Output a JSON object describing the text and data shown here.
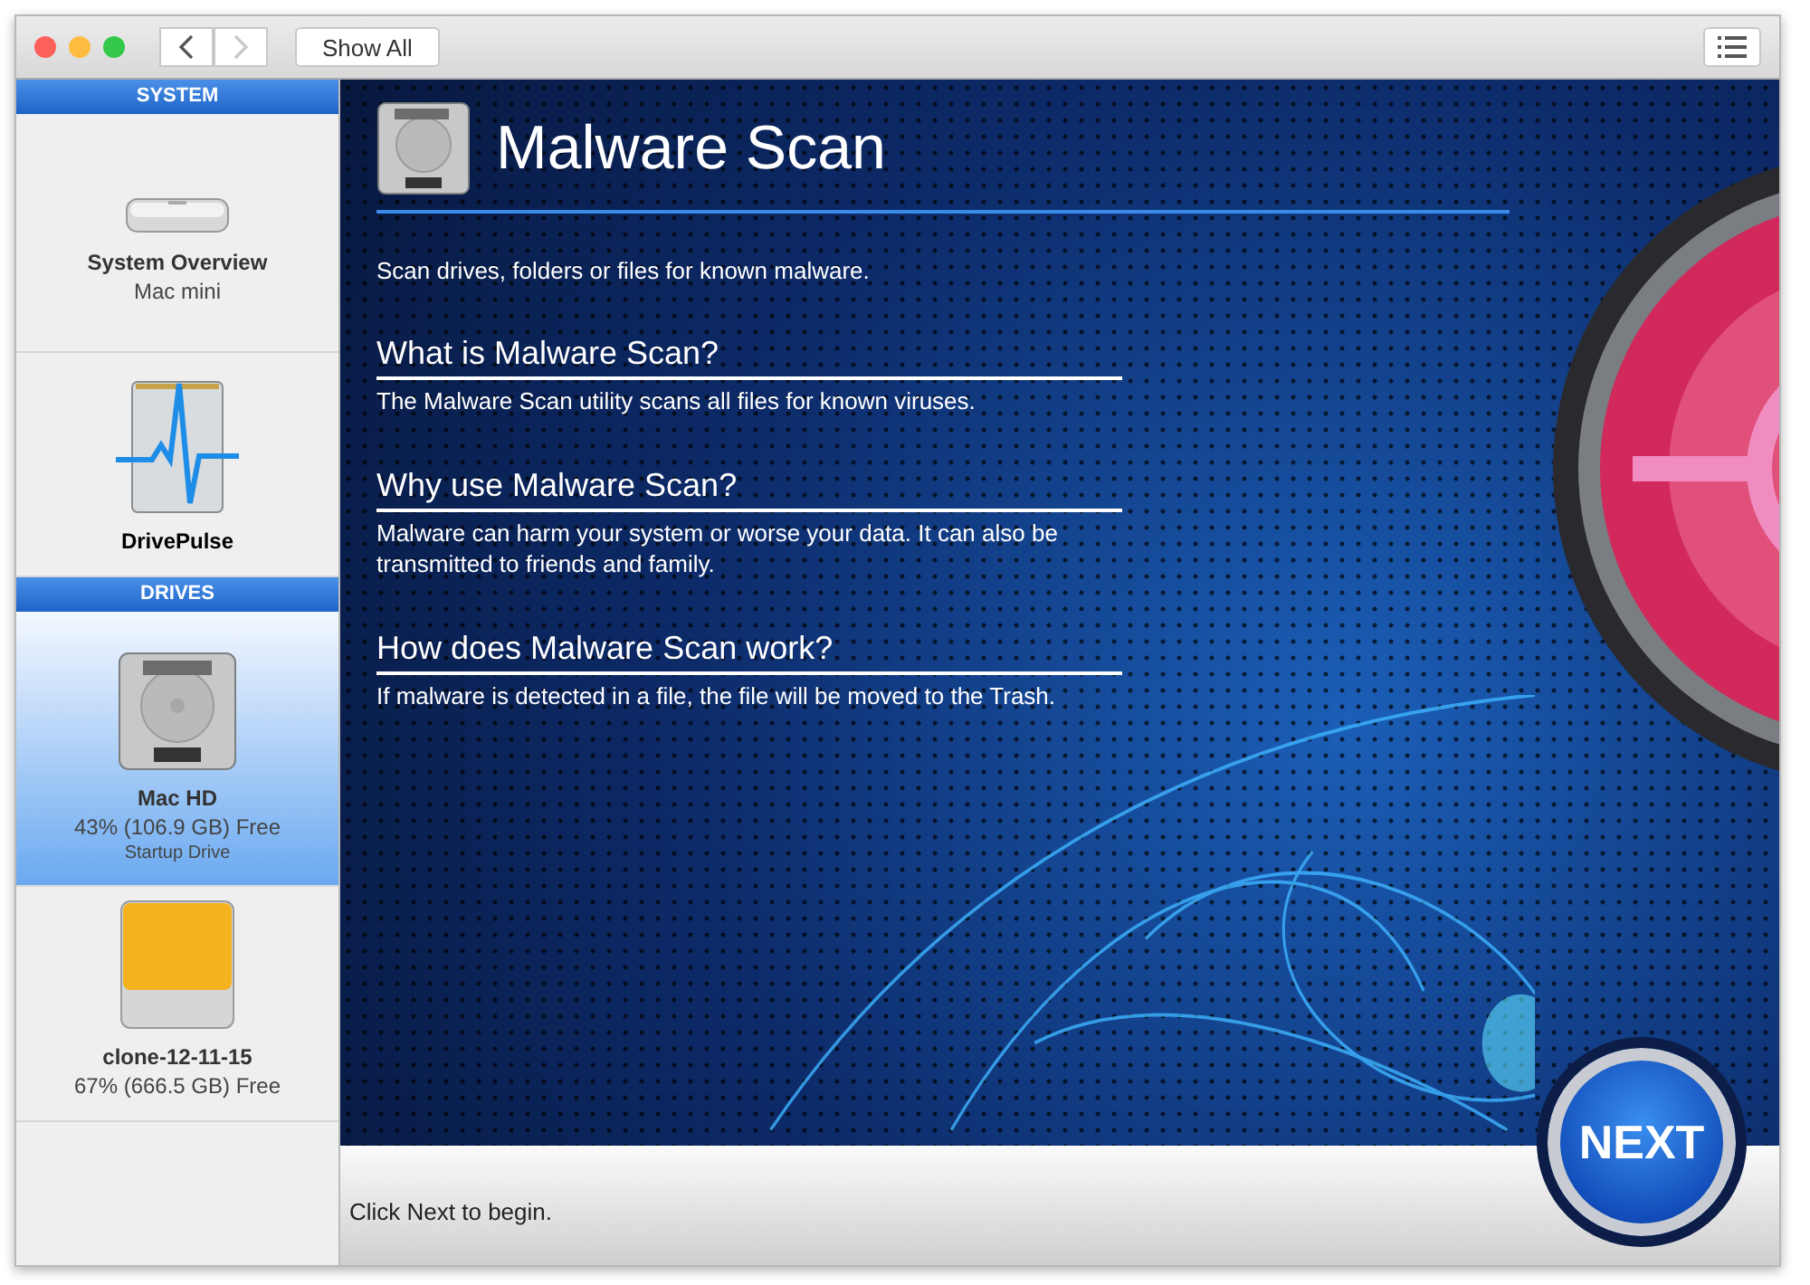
{
  "toolbar": {
    "nav": [
      {
        "kind": "back",
        "disabled": false
      },
      {
        "kind": "forward",
        "disabled": true
      }
    ],
    "show_all": "Show All"
  },
  "sidebar": {
    "sections": [
      {
        "title": "SYSTEM",
        "items": [
          {
            "kind": "mac-mini",
            "name": "System Overview",
            "detail": "Mac mini",
            "selected": false
          },
          {
            "kind": "pulse",
            "name": "DrivePulse",
            "selected": false
          }
        ]
      },
      {
        "title": "DRIVES",
        "items": [
          {
            "kind": "hdd",
            "name": "Mac HD",
            "detail": "43% (106.9 GB) Free",
            "note": "Startup Drive",
            "selected": true
          },
          {
            "kind": "external",
            "name": "clone-12-11-15",
            "detail": "67% (666.5 GB) Free",
            "selected": false
          }
        ]
      }
    ]
  },
  "content": {
    "title": "Malware Scan",
    "intro": "Scan drives, folders or files for known malware.",
    "sections": [
      {
        "heading": "What is Malware Scan?",
        "text": "The Malware Scan utility scans all files for known viruses."
      },
      {
        "heading": "Why use Malware Scan?",
        "text": "Malware can harm your system or worse your data. It can also be transmitted to friends and family."
      },
      {
        "heading": "How does Malware Scan work?",
        "text": "If malware is detected in a file, the file will be moved to the Trash."
      }
    ]
  },
  "footer": {
    "hint": "Click Next to begin.",
    "next_button": "NEXT"
  }
}
